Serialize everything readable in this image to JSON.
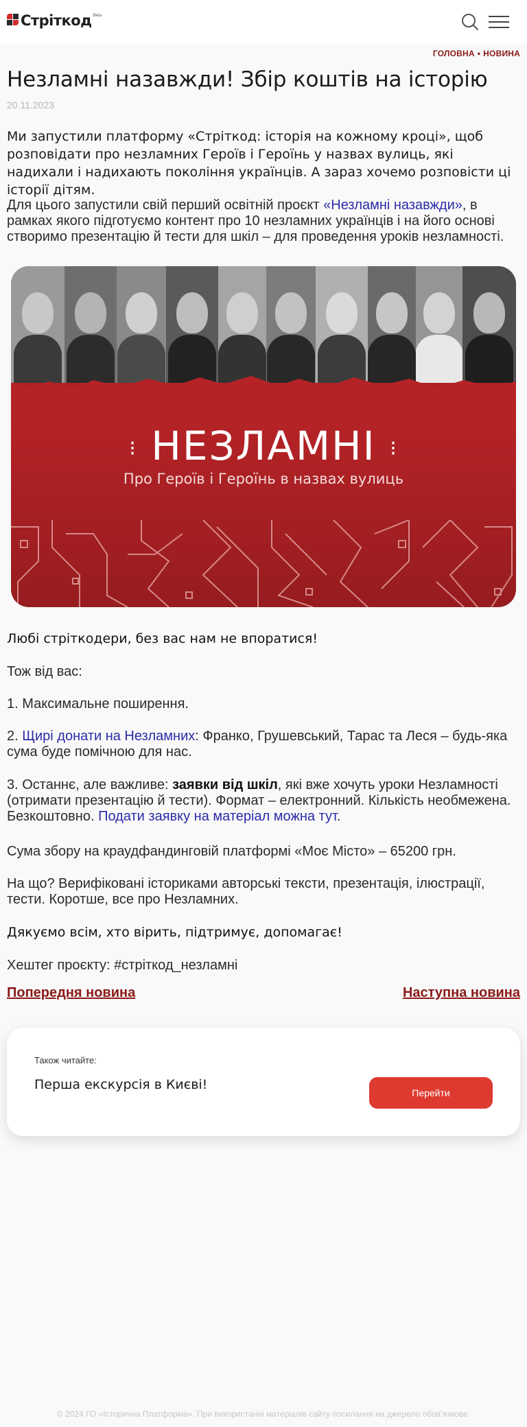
{
  "header": {
    "logo_text": "Стріткод",
    "logo_beta": "Beta",
    "brand_colors": {
      "mark_red": "#d42b2b",
      "mark_dark": "#2a2a2a"
    },
    "icons": [
      "search-icon",
      "menu-icon"
    ]
  },
  "breadcrumb": {
    "home": "ГОЛОВНА",
    "separator": "•",
    "current": "НОВИНА"
  },
  "article": {
    "title": "Незламні назавжди! Збір коштів на історію",
    "date": "20.11.2023",
    "lead": "Ми запустили платформу «Стріткод: історія на кожному кроці», щоб розповідати про незламних Героїв і Героїнь у назвах вулиць, які надихали і надихають покоління українців. А зараз хочемо розповісти ці історії дітям.",
    "p1_before": "Для цього запустили свій перший освітній проєкт ",
    "p1_link": "«Незламні назавжди»",
    "p1_after": ", в рамках якого підготуємо контент про 10 незламних українців і на його основі створимо презентацію й тести для шкіл – для проведення уроків незламності.",
    "banner_title": "НЕЗЛАМНІ",
    "banner_subtitle": "Про Героїв і Героїнь в назвах вулиць",
    "appeal": "Любі стріткодери, без вас нам не впоратися!",
    "from_you": "Тож від вас:",
    "item1": "1. Максимальне поширення.",
    "item2_prefix": "2. ",
    "item2_link": "Щирі донати на Незламних",
    "item2_after": ": Франко, Грушевський, Тарас та Леся – будь-яка сума буде помічною для нас.",
    "item3_prefix": "3. Останнє, але важливе: ",
    "item3_bold": "заявки від шкіл",
    "item3_after": ", які вже хочуть уроки Незламності (отримати презентацію й тести). Формат – електронний. Кількість необмежена. Безкоштовно. ",
    "item3_link": "Подати заявку на матеріал можна тут",
    "item3_end": ".",
    "sum": "Сума збору на краудфандинговій платформі «Моє Місто» – 65200 грн.",
    "purpose": "На що? Верифіковані істориками авторські тексти, презентація, ілюстрації, тести. Коротше, все про Незламних.",
    "thanks": "Дякуємо всім, хто вірить, підтримує, допомагає!",
    "hashtag": "Хештег проєкту: #стріткод_незламні"
  },
  "pagination": {
    "prev": "Попередня новина",
    "next": "Наступна новина"
  },
  "related": {
    "label": "Також читайте:",
    "title": "Перша екскурсія в Києві!",
    "button": "Перейти"
  },
  "footer": {
    "text": "© 2024 ГО «Історична Платформа». При використанні матеріалів сайту посилання на джерело обов’язкове."
  }
}
